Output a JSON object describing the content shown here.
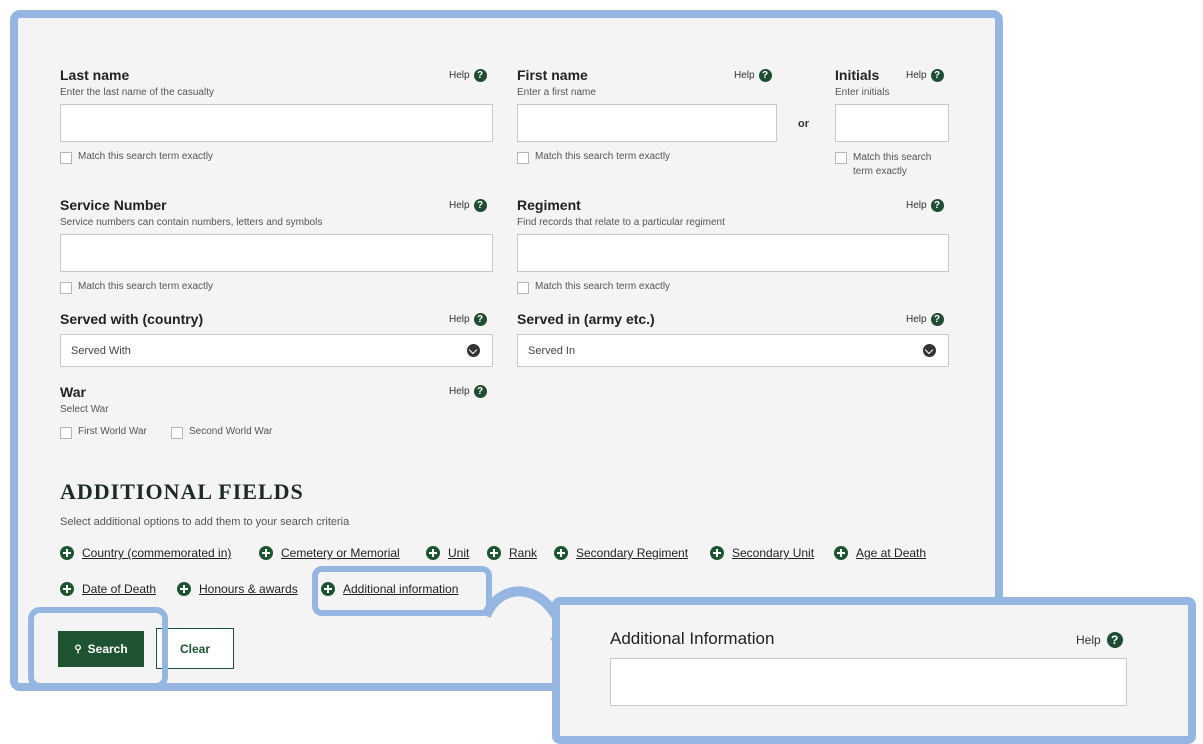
{
  "form": {
    "last_name": {
      "label": "Last name",
      "hint": "Enter the last name of the casualty",
      "help": "Help",
      "value": "",
      "exact": "Match this search term exactly"
    },
    "first_name": {
      "label": "First name",
      "hint": "Enter a first name",
      "help": "Help",
      "value": "",
      "exact": "Match this search term exactly"
    },
    "or_label": "or",
    "initials": {
      "label": "Initials",
      "hint": "Enter initials",
      "help": "Help",
      "value": "",
      "exact_line1": "Match this search",
      "exact_line2": "term exactly"
    },
    "service_number": {
      "label": "Service Number",
      "hint": "Service numbers can contain numbers, letters and symbols",
      "help": "Help",
      "value": "",
      "exact": "Match this search term exactly"
    },
    "regiment": {
      "label": "Regiment",
      "hint": "Find records that relate to a particular regiment",
      "help": "Help",
      "value": "",
      "exact": "Match this search term exactly"
    },
    "served_with": {
      "label": "Served with (country)",
      "help": "Help",
      "selected": "Served With"
    },
    "served_in": {
      "label": "Served in (army etc.)",
      "help": "Help",
      "selected": "Served In"
    },
    "war": {
      "label": "War",
      "hint": "Select War",
      "help": "Help",
      "options": [
        "First World War",
        "Second World War"
      ]
    }
  },
  "additional": {
    "heading": "ADDITIONAL FIELDS",
    "hint": "Select additional options to add them to your search criteria",
    "row1": [
      "Country (commemorated in)",
      "Cemetery or Memorial",
      "Unit",
      "Rank",
      "Secondary Regiment",
      "Secondary Unit",
      "Age at Death"
    ],
    "row2": [
      "Date of Death",
      "Honours & awards",
      "Additional information"
    ]
  },
  "actions": {
    "search": "Search",
    "clear": "Clear"
  },
  "zoom_panel": {
    "label": "Additional Information",
    "help": "Help",
    "value": ""
  },
  "colors": {
    "highlight": "#95b6e1",
    "brand_green": "#1e5431",
    "panel_bg": "#f4f4f4"
  }
}
